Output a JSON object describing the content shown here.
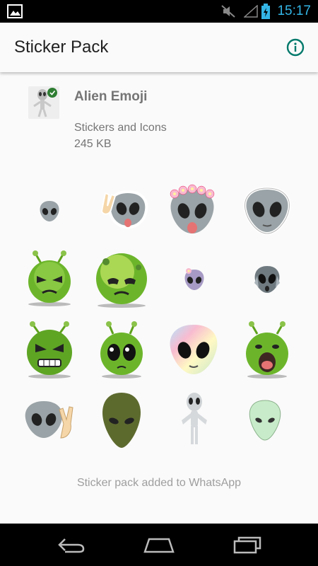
{
  "status_bar": {
    "time": "15:17"
  },
  "app_bar": {
    "title": "Sticker Pack"
  },
  "pack": {
    "name": "Alien Emoji",
    "publisher": "Stickers and Icons",
    "size": "245 KB"
  },
  "stickers": [
    "small-gray-alien",
    "peace-gray-alien-tongue",
    "flower-crown-alien-tongue",
    "gray-alien-outlined",
    "green-alien-angry",
    "green-alien-sad",
    "purple-alien-flower",
    "gray-alien-scream",
    "green-alien-furious",
    "green-alien-teary",
    "rainbow-alien",
    "green-alien-shock",
    "gray-alien-peace",
    "olive-alien-head",
    "standing-alien-figure",
    "mint-alien-head"
  ],
  "footer": {
    "status": "Sticker pack added to WhatsApp"
  },
  "colors": {
    "accent": "#00796b",
    "status_time": "#33b5e5"
  }
}
